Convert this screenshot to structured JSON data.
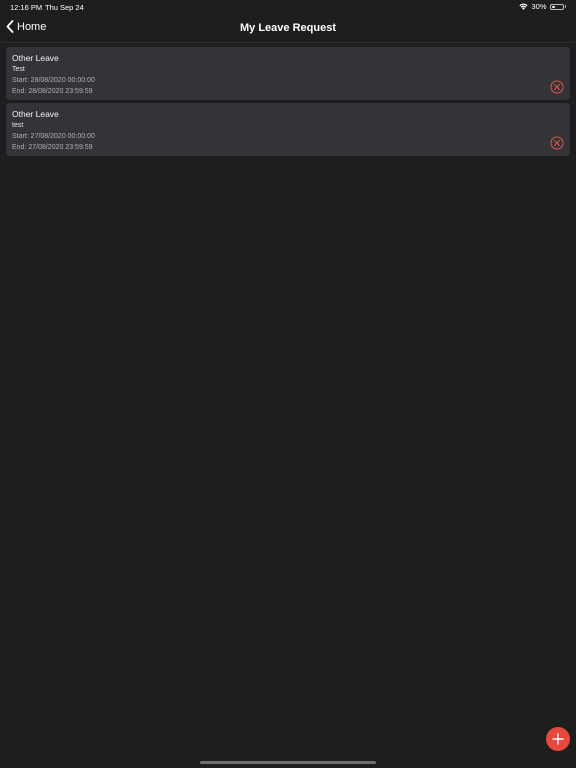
{
  "status_bar": {
    "time": "12:16 PM",
    "date": "Thu Sep 24",
    "battery": "30%",
    "battery_level": 0.3
  },
  "nav": {
    "back_label": "Home",
    "title": "My Leave Request"
  },
  "requests": [
    {
      "type": "Other Leave",
      "note": "Test",
      "start": "Start: 28/08/2020 00:00:00",
      "end": "End: 28/08/2020 23:59:59"
    },
    {
      "type": "Other Leave",
      "note": "test",
      "start": "Start: 27/08/2020 00:00:00",
      "end": "End: 27/08/2020 23:59:59"
    }
  ],
  "icons": {
    "back": "chevron-left-icon",
    "delete": "close-circle-icon",
    "add": "plus-icon",
    "wifi": "wifi-icon",
    "battery": "battery-icon"
  },
  "colors": {
    "background": "#1e1e1e",
    "card": "#333438",
    "accent": "#e8473c",
    "delete": "#e0574d"
  }
}
